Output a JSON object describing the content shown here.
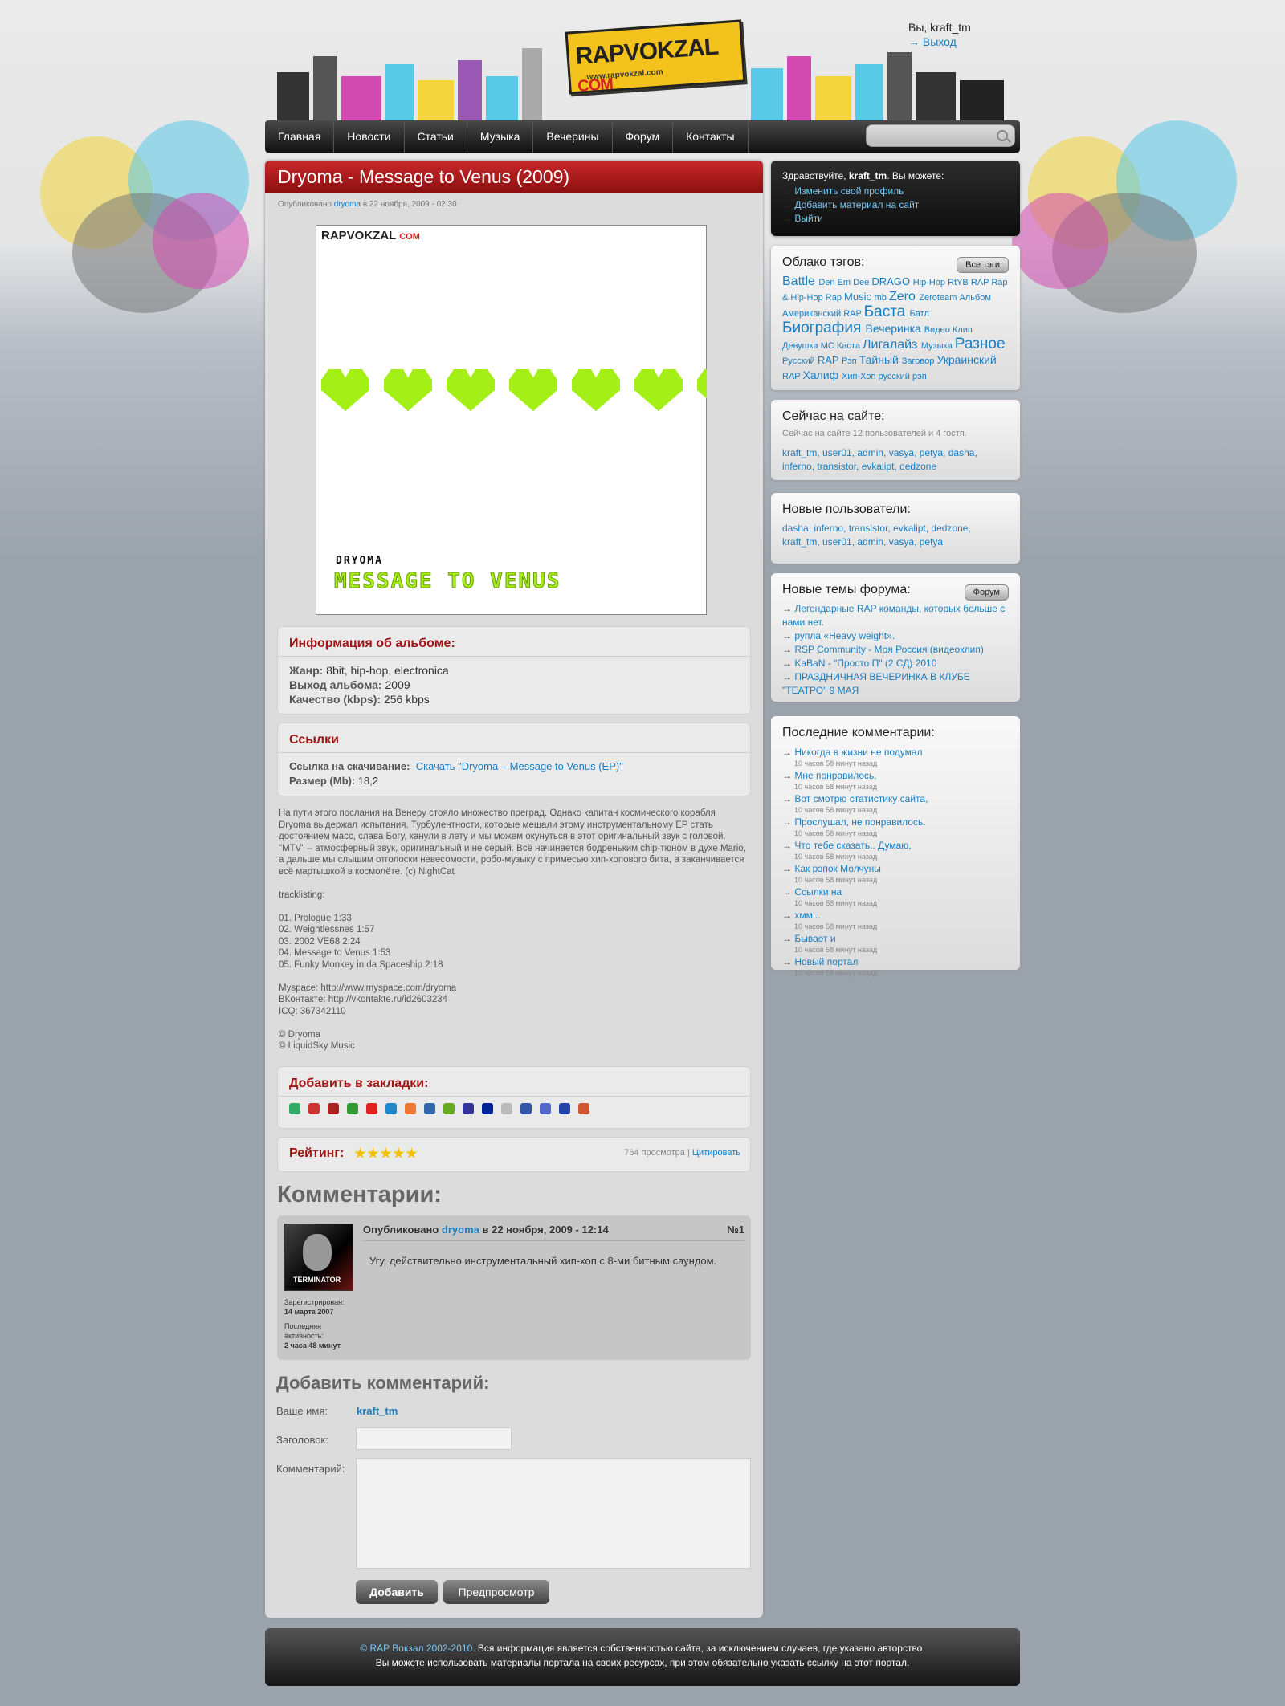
{
  "header": {
    "logo_text": "RAPVOKZAL",
    "logo_com": "COM",
    "logo_sub": "www.rapvokzal.com",
    "user_greeting": "Вы, kraft_tm",
    "logout": "→ Выход"
  },
  "nav": {
    "items": [
      "Главная",
      "Новости",
      "Статьи",
      "Музыка",
      "Вечерины",
      "Форум",
      "Контакты"
    ],
    "search_placeholder": ""
  },
  "post": {
    "title": "Dryoma - Message to Venus (2009)",
    "meta_prefix": "Опубликовано",
    "author": "dryoma",
    "meta_date": "в 22 ноября, 2009 - 02:30",
    "cover": {
      "logo": "RAPVOKZAL",
      "logo_com": "COM",
      "artist": "DRYOMA",
      "album": "MESSAGE TO VENUS",
      "hearts": 7
    },
    "album_info": {
      "heading": "Информация об альбоме:",
      "genre_label": "Жанр:",
      "genre": "8bit, hip-hop, electronica",
      "release_label": "Выход альбома:",
      "release": "2009",
      "quality_label": "Качество (kbps):",
      "quality": "256 kbps"
    },
    "links": {
      "heading": "Ссылки",
      "download_label": "Ссылка на скачивание:",
      "download_text": "Скачать \"Dryoma – Message to Venus (EP)\"",
      "size_label": "Размер (Mb):",
      "size": "18,2"
    },
    "text": "На пути этого послания на Венеру стояло множество преград. Однако капитан космического корабля\nDryoma выдержал испытания. Турбулентности, которые мешали этому инструментальному EP стать\nдостоянием масс, слава Богу, канули в лету и мы можем окунуться в этот оригинальный звук с головой.\n\"MTV\" – атмосферный звук, оригинальный и не серый. Всё начинается бодреньким chip-тюном в духе Mario,\nа дальше мы слышим отголоски невесомости, робо-музыку с примесью хип-хопового бита, а заканчивается\nвсё мартышкой в космолёте. (c) NightCat\n\ntracklisting:\n\n01. Prologue 1:33\n02. Weightlessnes 1:57\n03. 2002 VE68 2:24\n04. Message to Venus 1:53\n05. Funky Monkey in da Spaceship 2:18\n\nMyspace: http://www.myspace.com/dryoma\nВКонтакте: http://vkontakte.ru/id2603234\nICQ: 367342110\n\n© Dryoma\n© LiquidSky Music",
    "bookmarks_heading": "Добавить в закладки:",
    "bookmark_colors": [
      "#3a6",
      "#c33",
      "#a22",
      "#393",
      "#d22",
      "#28c",
      "#e73",
      "#36a",
      "#6a2",
      "#339",
      "#029",
      "#bbb",
      "#35a",
      "#56c",
      "#24a",
      "#c53"
    ],
    "rating_label": "Рейтинг:",
    "rating_stars": 5,
    "views": "764 просмотра",
    "sep": "|",
    "cite": "Цитировать"
  },
  "comments": {
    "heading": "Комментарии:",
    "items": [
      {
        "prefix": "Опубликовано",
        "author": "dryoma",
        "date": "в 22 ноября, 2009 - 12:14",
        "num": "№1",
        "text": "Угу, действительно инструментальный хип-хоп с 8-ми битным саундом.",
        "reg_label": "Зарегистрирован:",
        "reg_date": "14 марта 2007",
        "act_label": "Последняя активность:",
        "act_value": "2 часа 48 минут",
        "avatar_text": "TERMINATOR"
      }
    ]
  },
  "add_comment": {
    "heading": "Добавить комментарий:",
    "name_label": "Ваше имя:",
    "name_value": "kraft_tm",
    "subject_label": "Заголовок:",
    "comment_label": "Комментарий:",
    "submit": "Добавить",
    "preview": "Предпросмотр"
  },
  "sidebar": {
    "welcome": {
      "hello": "Здравствуйте,",
      "user": "kraft_tm",
      "tail": ". Вы можете:",
      "links": [
        "Изменить свой профиль",
        "Добавить материал на сайт",
        "Выйти"
      ]
    },
    "tags": {
      "heading": "Облако тэгов:",
      "all": "Все тэги",
      "items": [
        [
          "Battle",
          16
        ],
        [
          "Den Em Dee",
          11
        ],
        [
          "DRAGO",
          13
        ],
        [
          "Hip-Hop",
          11
        ],
        [
          "RtYB",
          11
        ],
        [
          "RAP",
          11
        ],
        [
          "Rap & Hip-Hop",
          11
        ],
        [
          "Rap",
          11
        ],
        [
          "Music",
          13
        ],
        [
          "mb",
          11
        ],
        [
          "Zero",
          16
        ],
        [
          "Zeroteam",
          11
        ],
        [
          "Альбом",
          11
        ],
        [
          "Американский",
          11
        ],
        [
          "RAP",
          11
        ],
        [
          "Баста",
          19
        ],
        [
          "Батл",
          11
        ],
        [
          "Биография",
          19
        ],
        [
          "Вечеринка",
          14
        ],
        [
          "Видео",
          11
        ],
        [
          "Клип",
          11
        ],
        [
          "Девушка",
          11
        ],
        [
          "MC",
          11
        ],
        [
          "Каста",
          11
        ],
        [
          "Лигалайз",
          16
        ],
        [
          "Музыка",
          11
        ],
        [
          "Разное",
          19
        ],
        [
          "Русский",
          11
        ],
        [
          "RAP",
          13
        ],
        [
          "Рэп",
          11
        ],
        [
          "Тайный",
          14
        ],
        [
          "Заговор",
          11
        ],
        [
          "Украинский",
          14
        ],
        [
          "RAP",
          11
        ],
        [
          "Халиф",
          14
        ],
        [
          "Хип-Хоп",
          11
        ],
        [
          "русский рэп",
          11
        ]
      ]
    },
    "online": {
      "heading": "Сейчас на сайте:",
      "note": "Сейчас на сайте 12 пользователей и 4 гостя.",
      "users": "kraft_tm, user01, admin, vasya, petya, dasha, inferno, transistor, evkalipt, dedzone"
    },
    "new_users": {
      "heading": "Новые пользователи:",
      "users": "dasha, inferno, transistor, evkalipt, dedzone, kraft_tm, user01, admin, vasya, petya"
    },
    "forum": {
      "heading": "Новые темы форума:",
      "button": "Форум",
      "items": [
        "Легендарные RAP команды, которых больше с нами нет.",
        "рупла «Heavy weight».",
        "RSP Community - Моя Россия (видеоклип)",
        "KaBaN - \"Просто П\" (2 СД) 2010",
        "ПРАЗДНИЧНАЯ ВЕЧЕРИНКА В КЛУБЕ \"ТЕАТРО\" 9 МАЯ"
      ]
    },
    "last_comments": {
      "heading": "Последние комментарии:",
      "items": [
        [
          "Никогда в жизни не подумал",
          "10 часов 58 минут назад"
        ],
        [
          "Мне понравилось.",
          "10 часов 58 минут назад"
        ],
        [
          "Вот смотрю статистику сайта,",
          "10 часов 58 минут назад"
        ],
        [
          "Прослушал, не понравилось.",
          "10 часов 58 минут назад"
        ],
        [
          "Что тебе сказать.. Думаю,",
          "10 часов 58 минут назад"
        ],
        [
          "Как рэпок Молчуны",
          "10 часов 58 минут назад"
        ],
        [
          "Ссылки на",
          "10 часов 58 минут назад"
        ],
        [
          "хмм...",
          "10 часов 58 минут назад"
        ],
        [
          "Бывает и",
          "10 часов 58 минут назад"
        ],
        [
          "Новый портал",
          "10 часов 58 минут назад"
        ]
      ]
    }
  },
  "footer": {
    "copyright": "© RAP Вокзал 2002-2010.",
    "line1": " Вся информация является собственностью сайта, за исключением случаев, где указано авторство.",
    "line2": "Вы можете использовать материалы портала на своих ресурсах, при этом обязательно указать ссылку на этот портал."
  }
}
